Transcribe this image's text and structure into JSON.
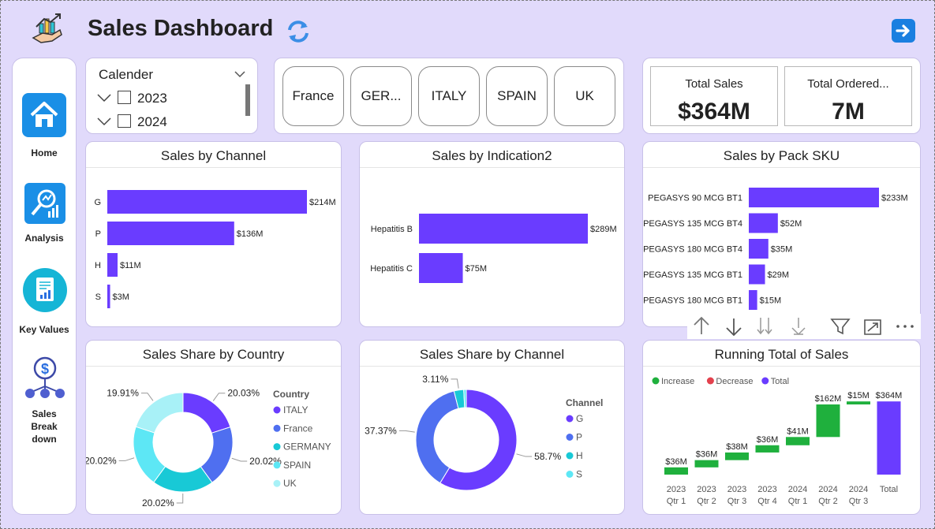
{
  "header": {
    "title": "Sales Dashboard"
  },
  "nav": {
    "home": "Home",
    "analysis": "Analysis",
    "key_values": "Key Values",
    "sales_breakdown": [
      "Sales",
      "Break",
      "down"
    ]
  },
  "slicer": {
    "title": "Calender",
    "options": [
      "2023",
      "2024"
    ]
  },
  "countries": [
    "France",
    "GER...",
    "ITALY",
    "SPAIN",
    "UK"
  ],
  "kpis": [
    {
      "label": "Total Sales",
      "value": "$364M"
    },
    {
      "label": "Total Ordered...",
      "value": "7M"
    }
  ],
  "chart_data": [
    {
      "type": "bar",
      "title": "Sales by Channel",
      "categories": [
        "G",
        "P",
        "H",
        "S"
      ],
      "values": [
        214,
        136,
        11,
        3
      ],
      "labels": [
        "$214M",
        "$136M",
        "$11M",
        "$3M"
      ],
      "color": "#6a3cff"
    },
    {
      "type": "bar",
      "title": "Sales by Indication2",
      "categories": [
        "Hepatitis B",
        "Hepatitis C"
      ],
      "values": [
        289,
        75
      ],
      "labels": [
        "$289M",
        "$75M"
      ],
      "color": "#6a3cff"
    },
    {
      "type": "bar",
      "title": "Sales by Pack SKU",
      "categories": [
        "PEGASYS 90 MCG BT1",
        "PEGASYS 135 MCG BT4",
        "PEGASYS 180 MCG BT4",
        "PEGASYS 135 MCG BT1",
        "PEGASYS 180 MCG BT1"
      ],
      "values": [
        233,
        52,
        35,
        29,
        15
      ],
      "labels": [
        "$233M",
        "$52M",
        "$35M",
        "$29M",
        "$15M"
      ],
      "color": "#6a3cff"
    },
    {
      "type": "pie",
      "title": "Sales Share by Country",
      "legend_title": "Country",
      "slices": [
        {
          "name": "ITALY",
          "value": 20.03,
          "label": "20.03%",
          "color": "#6a3cff"
        },
        {
          "name": "France",
          "value": 20.02,
          "label": "20.02%",
          "color": "#4f6ff0"
        },
        {
          "name": "GERMANY",
          "value": 20.02,
          "label": "20.02%",
          "color": "#18c9d6"
        },
        {
          "name": "SPAIN",
          "value": 20.02,
          "label": "20.02%",
          "color": "#5de7f5"
        },
        {
          "name": "UK",
          "value": 19.91,
          "label": "19.91%",
          "color": "#a8f1f7"
        }
      ]
    },
    {
      "type": "pie",
      "title": "Sales Share by Channel",
      "legend_title": "Channel",
      "slices": [
        {
          "name": "G",
          "value": 58.7,
          "label": "58.7%",
          "color": "#6a3cff"
        },
        {
          "name": "P",
          "value": 37.37,
          "label": "37.37%",
          "color": "#4f6ff0"
        },
        {
          "name": "H",
          "value": 3.11,
          "label": "3.11%",
          "color": "#18c9d6"
        },
        {
          "name": "S",
          "value": 0.82,
          "label": "",
          "color": "#5de7f5"
        }
      ]
    },
    {
      "type": "waterfall",
      "title": "Running Total of Sales",
      "legend": [
        {
          "name": "Increase",
          "color": "#1fb03d"
        },
        {
          "name": "Decrease",
          "color": "#e3414d"
        },
        {
          "name": "Total",
          "color": "#6a3cff"
        }
      ],
      "steps": [
        {
          "x": [
            "2023",
            "Qtr 1"
          ],
          "value": 36,
          "label": "$36M"
        },
        {
          "x": [
            "2023",
            "Qtr 2"
          ],
          "value": 36,
          "label": "$36M"
        },
        {
          "x": [
            "2023",
            "Qtr 3"
          ],
          "value": 38,
          "label": "$38M"
        },
        {
          "x": [
            "2023",
            "Qtr 4"
          ],
          "value": 36,
          "label": "$36M"
        },
        {
          "x": [
            "2024",
            "Qtr 1"
          ],
          "value": 41,
          "label": "$41M"
        },
        {
          "x": [
            "2024",
            "Qtr 2"
          ],
          "value": 162,
          "label": "$162M"
        },
        {
          "x": [
            "2024",
            "Qtr 3"
          ],
          "value": 15,
          "label": "$15M"
        }
      ],
      "total": {
        "x": [
          "Total"
        ],
        "value": 364,
        "label": "$364M"
      }
    }
  ]
}
